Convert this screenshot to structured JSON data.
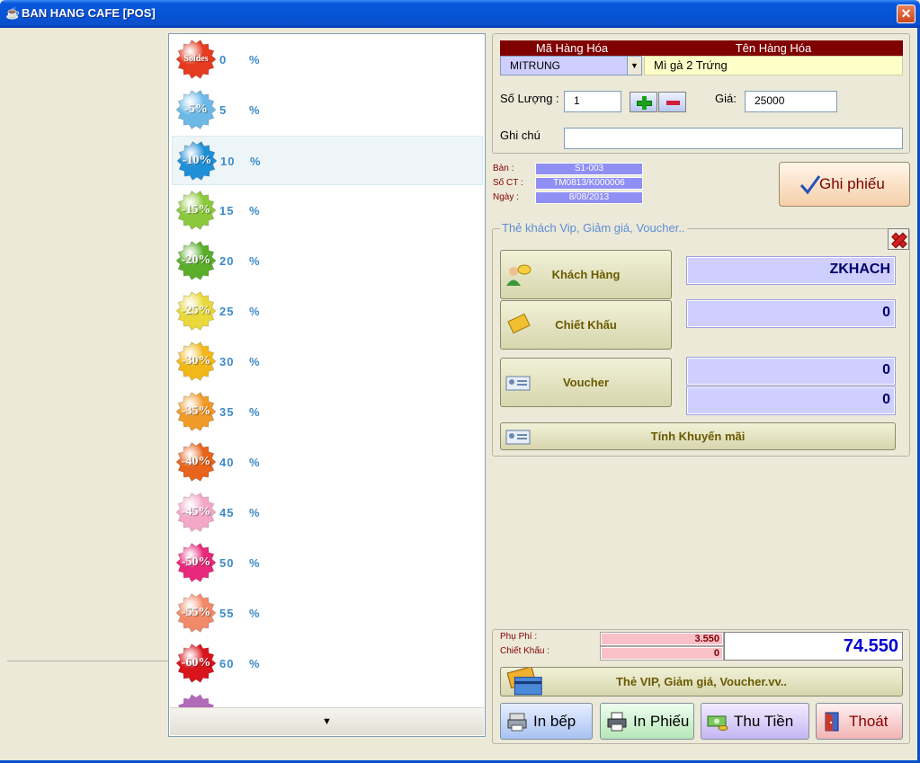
{
  "window": {
    "title": "BAN HANG CAFE [POS]",
    "close_label": "✕"
  },
  "discounts": [
    {
      "value": "0",
      "badge": "Soldes",
      "color": "#e53b1f"
    },
    {
      "value": "5",
      "badge": "-5%",
      "color": "#6cb9e8"
    },
    {
      "value": "10",
      "badge": "-10%",
      "color": "#1f8fd8"
    },
    {
      "value": "15",
      "badge": "-15%",
      "color": "#8cc83c"
    },
    {
      "value": "20",
      "badge": "-20%",
      "color": "#5aae2a"
    },
    {
      "value": "25",
      "badge": "-25%",
      "color": "#e8d83a"
    },
    {
      "value": "30",
      "badge": "-30%",
      "color": "#f2b81a"
    },
    {
      "value": "35",
      "badge": "-35%",
      "color": "#f09a28"
    },
    {
      "value": "40",
      "badge": "-40%",
      "color": "#e8641c"
    },
    {
      "value": "45",
      "badge": "-45%",
      "color": "#f4a8c8"
    },
    {
      "value": "50",
      "badge": "-50%",
      "color": "#e8287a"
    },
    {
      "value": "55",
      "badge": "-55%",
      "color": "#f28a6a"
    },
    {
      "value": "60",
      "badge": "-60%",
      "color": "#d8141c"
    }
  ],
  "pct_symbol": "%",
  "scroll_down": "▼",
  "item": {
    "code_header": "Mã Hàng Hóa",
    "name_header": "Tên Hàng Hóa",
    "code_value": "MITRUNG",
    "name_value": "Mì gà 2 Trứng",
    "qty_label": "Số Lượng :",
    "qty_value": "1",
    "price_label": "Giá:",
    "price_value": "25000",
    "note_label": "Ghi chú",
    "note_value": ""
  },
  "info": {
    "table_label": "Bàn :",
    "table_value": "S1-003",
    "doc_label": "Số CT :",
    "doc_value": "TM0813/K000006",
    "date_label": "Ngày :",
    "date_value": "8/08/2013"
  },
  "ghi_phieu": "Ghi phiếu",
  "promo": {
    "group_title": "Thẻ khách Vip, Giảm giá, Voucher..",
    "customer_button": "Khách Hàng",
    "customer_value": "ZKHACH",
    "discount_button": "Chiết Khấu",
    "discount_value": "0",
    "voucher_button": "Voucher",
    "voucher_value_1": "0",
    "voucher_value_2": "0",
    "calc_promo_button": "Tính Khuyến mãi"
  },
  "summary": {
    "fee_label": "Phụ Phí :",
    "fee_value": "3.550",
    "discount_label": "Chiết Khấu :",
    "discount_value": "0",
    "total": "74.550",
    "vip_button": "Thẻ VIP, Giảm giá, Voucher.vv.."
  },
  "actions": {
    "kitchen": "In bếp",
    "print": "In Phiếu",
    "collect": "Thu Tiền",
    "exit": "Thoát"
  }
}
